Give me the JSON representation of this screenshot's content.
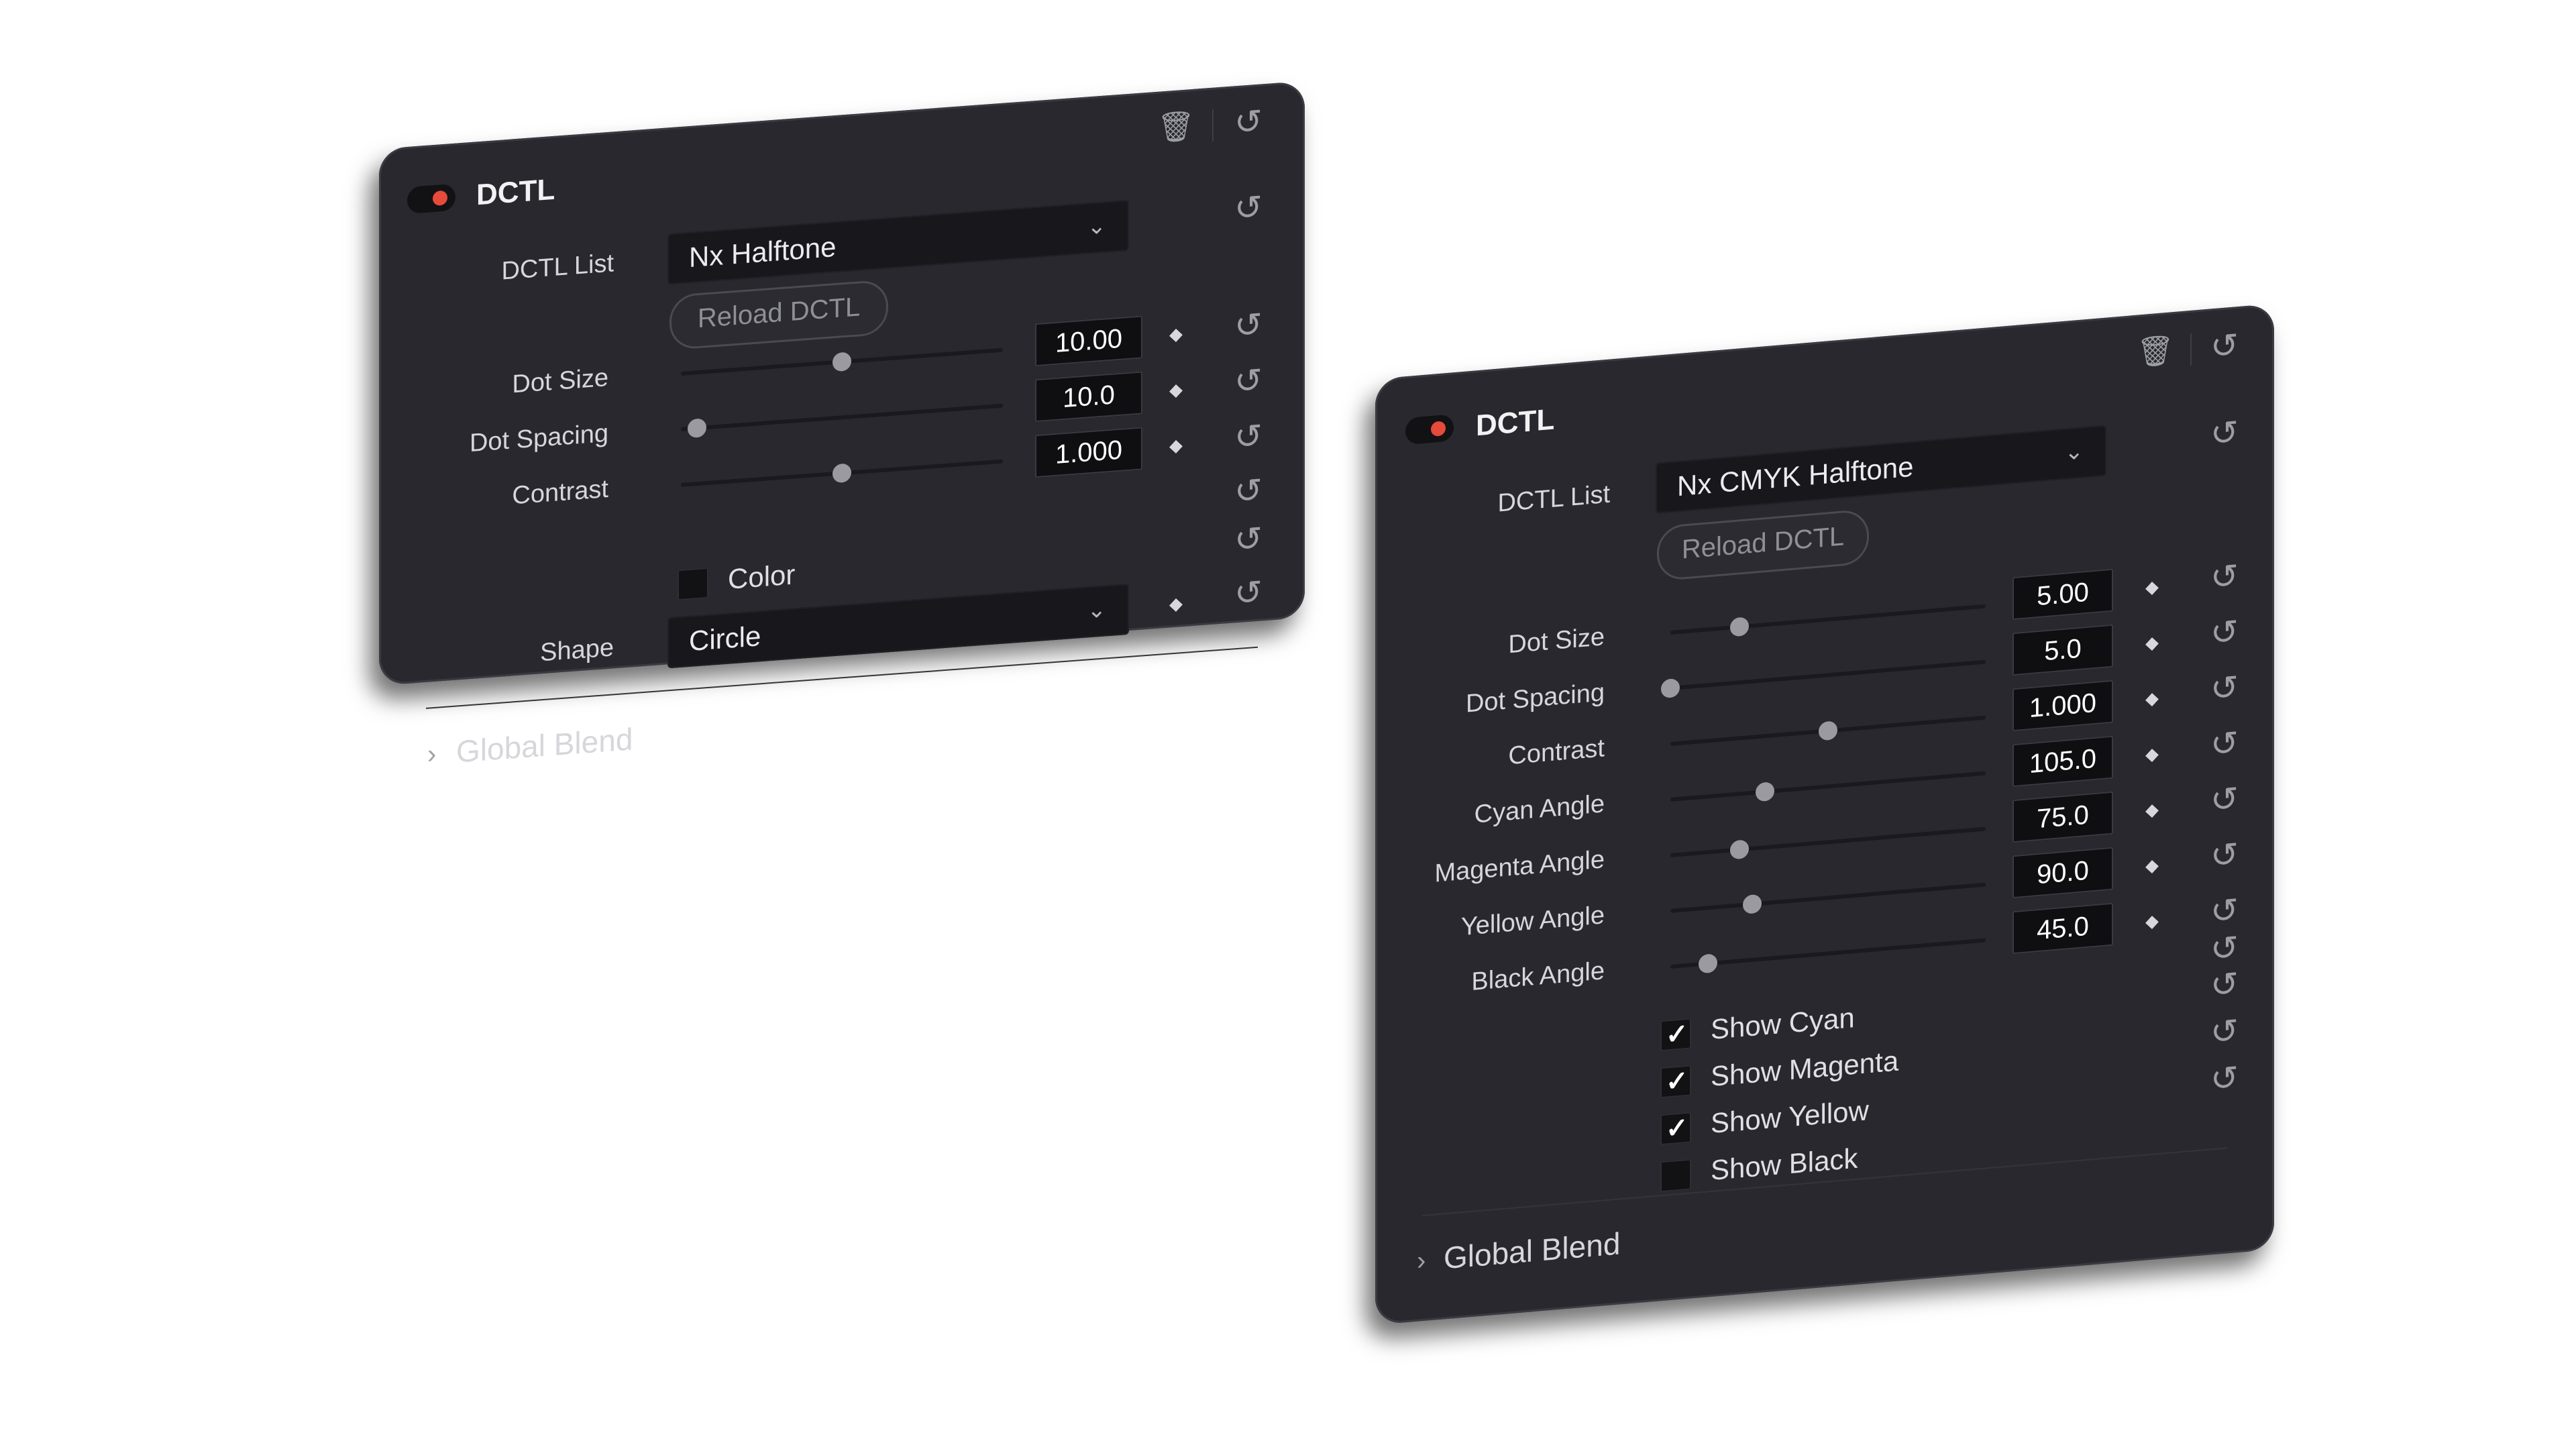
{
  "panel_left": {
    "title": "DCTL",
    "dctl_list_label": "DCTL List",
    "dctl_list_value": "Nx Halftone",
    "reload_label": "Reload DCTL",
    "params": [
      {
        "label": "Dot Size",
        "value": "10.00",
        "level": 0.5
      },
      {
        "label": "Dot Spacing",
        "value": "10.0",
        "level": 0.05
      },
      {
        "label": "Contrast",
        "value": "1.000",
        "level": 0.5
      }
    ],
    "color_label": "Color",
    "color_checked": false,
    "shape_label": "Shape",
    "shape_value": "Circle",
    "global_blend_label": "Global Blend"
  },
  "panel_right": {
    "title": "DCTL",
    "dctl_list_label": "DCTL List",
    "dctl_list_value": "Nx CMYK Halftone",
    "reload_label": "Reload DCTL",
    "params": [
      {
        "label": "Dot Size",
        "value": "5.00",
        "level": 0.22
      },
      {
        "label": "Dot Spacing",
        "value": "5.0",
        "level": 0.0
      },
      {
        "label": "Contrast",
        "value": "1.000",
        "level": 0.5
      },
      {
        "label": "Cyan Angle",
        "value": "105.0",
        "level": 0.3
      },
      {
        "label": "Magenta Angle",
        "value": "75.0",
        "level": 0.22
      },
      {
        "label": "Yellow Angle",
        "value": "90.0",
        "level": 0.26
      },
      {
        "label": "Black Angle",
        "value": "45.0",
        "level": 0.12
      }
    ],
    "checkboxes": [
      {
        "label": "Show Cyan",
        "checked": true
      },
      {
        "label": "Show Magenta",
        "checked": true
      },
      {
        "label": "Show Yellow",
        "checked": true
      },
      {
        "label": "Show Black",
        "checked": false
      }
    ],
    "global_blend_label": "Global Blend"
  },
  "icons": {
    "reset": "↺",
    "keyframe": "◆",
    "trash": "🗑",
    "chevron_down": "⌄",
    "chevron_right": "›",
    "check": "✓"
  },
  "colors": {
    "panel_bg": "#28282e",
    "node_dot": "#e64a3a",
    "value_box": "#0f0f12"
  }
}
